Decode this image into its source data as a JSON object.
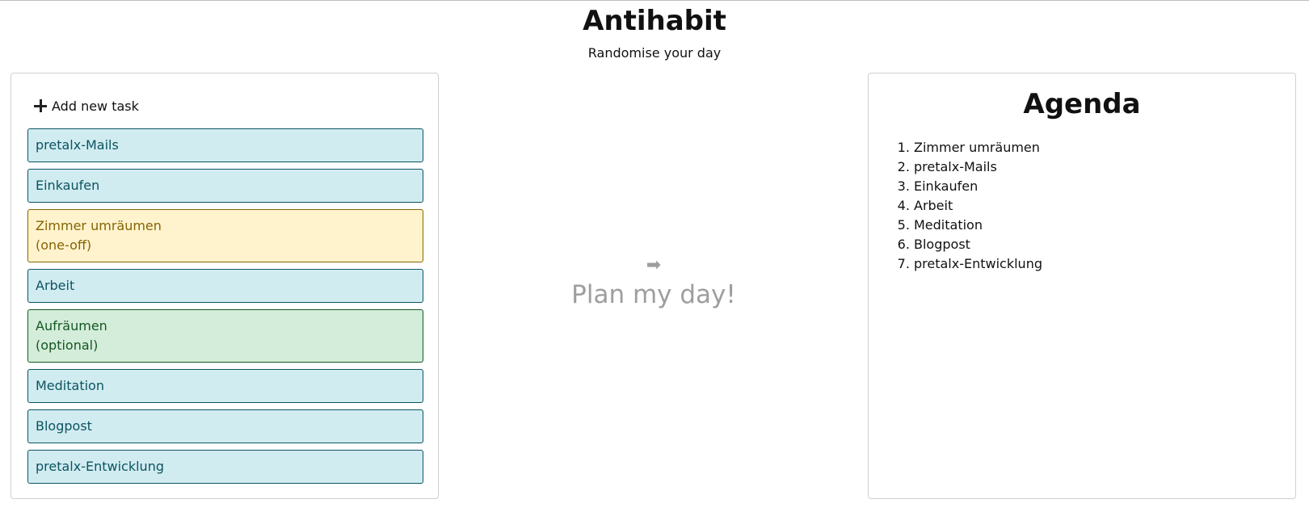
{
  "header": {
    "title": "Antihabit",
    "subtitle": "Randomise your day"
  },
  "tasks_panel": {
    "add_label": "Add new task",
    "add_icon": "plus-icon",
    "tasks": [
      {
        "label": "pretalx-Mails",
        "note": "",
        "kind": "regular"
      },
      {
        "label": "Einkaufen",
        "note": "",
        "kind": "regular"
      },
      {
        "label": "Zimmer umräumen",
        "note": "(one-off)",
        "kind": "one-off"
      },
      {
        "label": "Arbeit",
        "note": "",
        "kind": "regular"
      },
      {
        "label": "Aufräumen",
        "note": "(optional)",
        "kind": "optional"
      },
      {
        "label": "Meditation",
        "note": "",
        "kind": "regular"
      },
      {
        "label": "Blogpost",
        "note": "",
        "kind": "regular"
      },
      {
        "label": "pretalx-Entwicklung",
        "note": "",
        "kind": "regular"
      }
    ]
  },
  "plan": {
    "icon": "arrow-right-icon",
    "arrow_glyph": "➡",
    "label": "Plan my day!"
  },
  "agenda": {
    "title": "Agenda",
    "items": [
      "Zimmer umräumen",
      "pretalx-Mails",
      "Einkaufen",
      "Arbeit",
      "Meditation",
      "Blogpost",
      "pretalx-Entwicklung"
    ]
  },
  "colors": {
    "regular_bg": "#d1ecf1",
    "regular_fg": "#0c5460",
    "one_off_bg": "#fff3cd",
    "one_off_fg": "#856404",
    "optional_bg": "#d4edda",
    "optional_fg": "#155724",
    "plan_fg": "#9e9e9e"
  }
}
